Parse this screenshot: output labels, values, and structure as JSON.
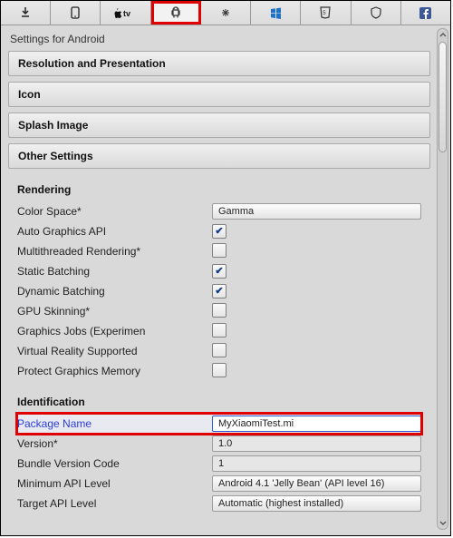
{
  "title": "Settings for Android",
  "tabs": [
    {
      "name": "standalone",
      "selected": false
    },
    {
      "name": "ios",
      "selected": false
    },
    {
      "name": "apple-tv",
      "selected": false
    },
    {
      "name": "android",
      "selected": true
    },
    {
      "name": "tizen",
      "selected": false
    },
    {
      "name": "windows-store",
      "selected": false
    },
    {
      "name": "webgl",
      "selected": false
    },
    {
      "name": "samsung-tv",
      "selected": false
    },
    {
      "name": "facebook",
      "selected": false
    }
  ],
  "sections": {
    "resolution": "Resolution and Presentation",
    "icon": "Icon",
    "splash": "Splash Image",
    "other": "Other Settings"
  },
  "rendering": {
    "header": "Rendering",
    "color_space_label": "Color Space*",
    "color_space_value": "Gamma",
    "auto_graphics_label": "Auto Graphics API",
    "auto_graphics": true,
    "multithreaded_label": "Multithreaded Rendering*",
    "multithreaded": false,
    "static_batch_label": "Static Batching",
    "static_batch": true,
    "dynamic_batch_label": "Dynamic Batching",
    "dynamic_batch": true,
    "gpu_skin_label": "GPU Skinning*",
    "gpu_skin": false,
    "graphics_jobs_label": "Graphics Jobs (Experimen",
    "graphics_jobs": false,
    "vr_supported_label": "Virtual Reality Supported",
    "vr_supported": false,
    "protect_mem_label": "Protect Graphics Memory",
    "protect_mem": false
  },
  "identification": {
    "header": "Identification",
    "package_name_label": "Package Name",
    "package_name_value": "MyXiaomiTest.mi",
    "version_label": "Version*",
    "version_value": "1.0",
    "bundle_code_label": "Bundle Version Code",
    "bundle_code_value": "1",
    "min_api_label": "Minimum API Level",
    "min_api_value": "Android 4.1 'Jelly Bean' (API level 16)",
    "target_api_label": "Target API Level",
    "target_api_value": "Automatic (highest installed)"
  }
}
